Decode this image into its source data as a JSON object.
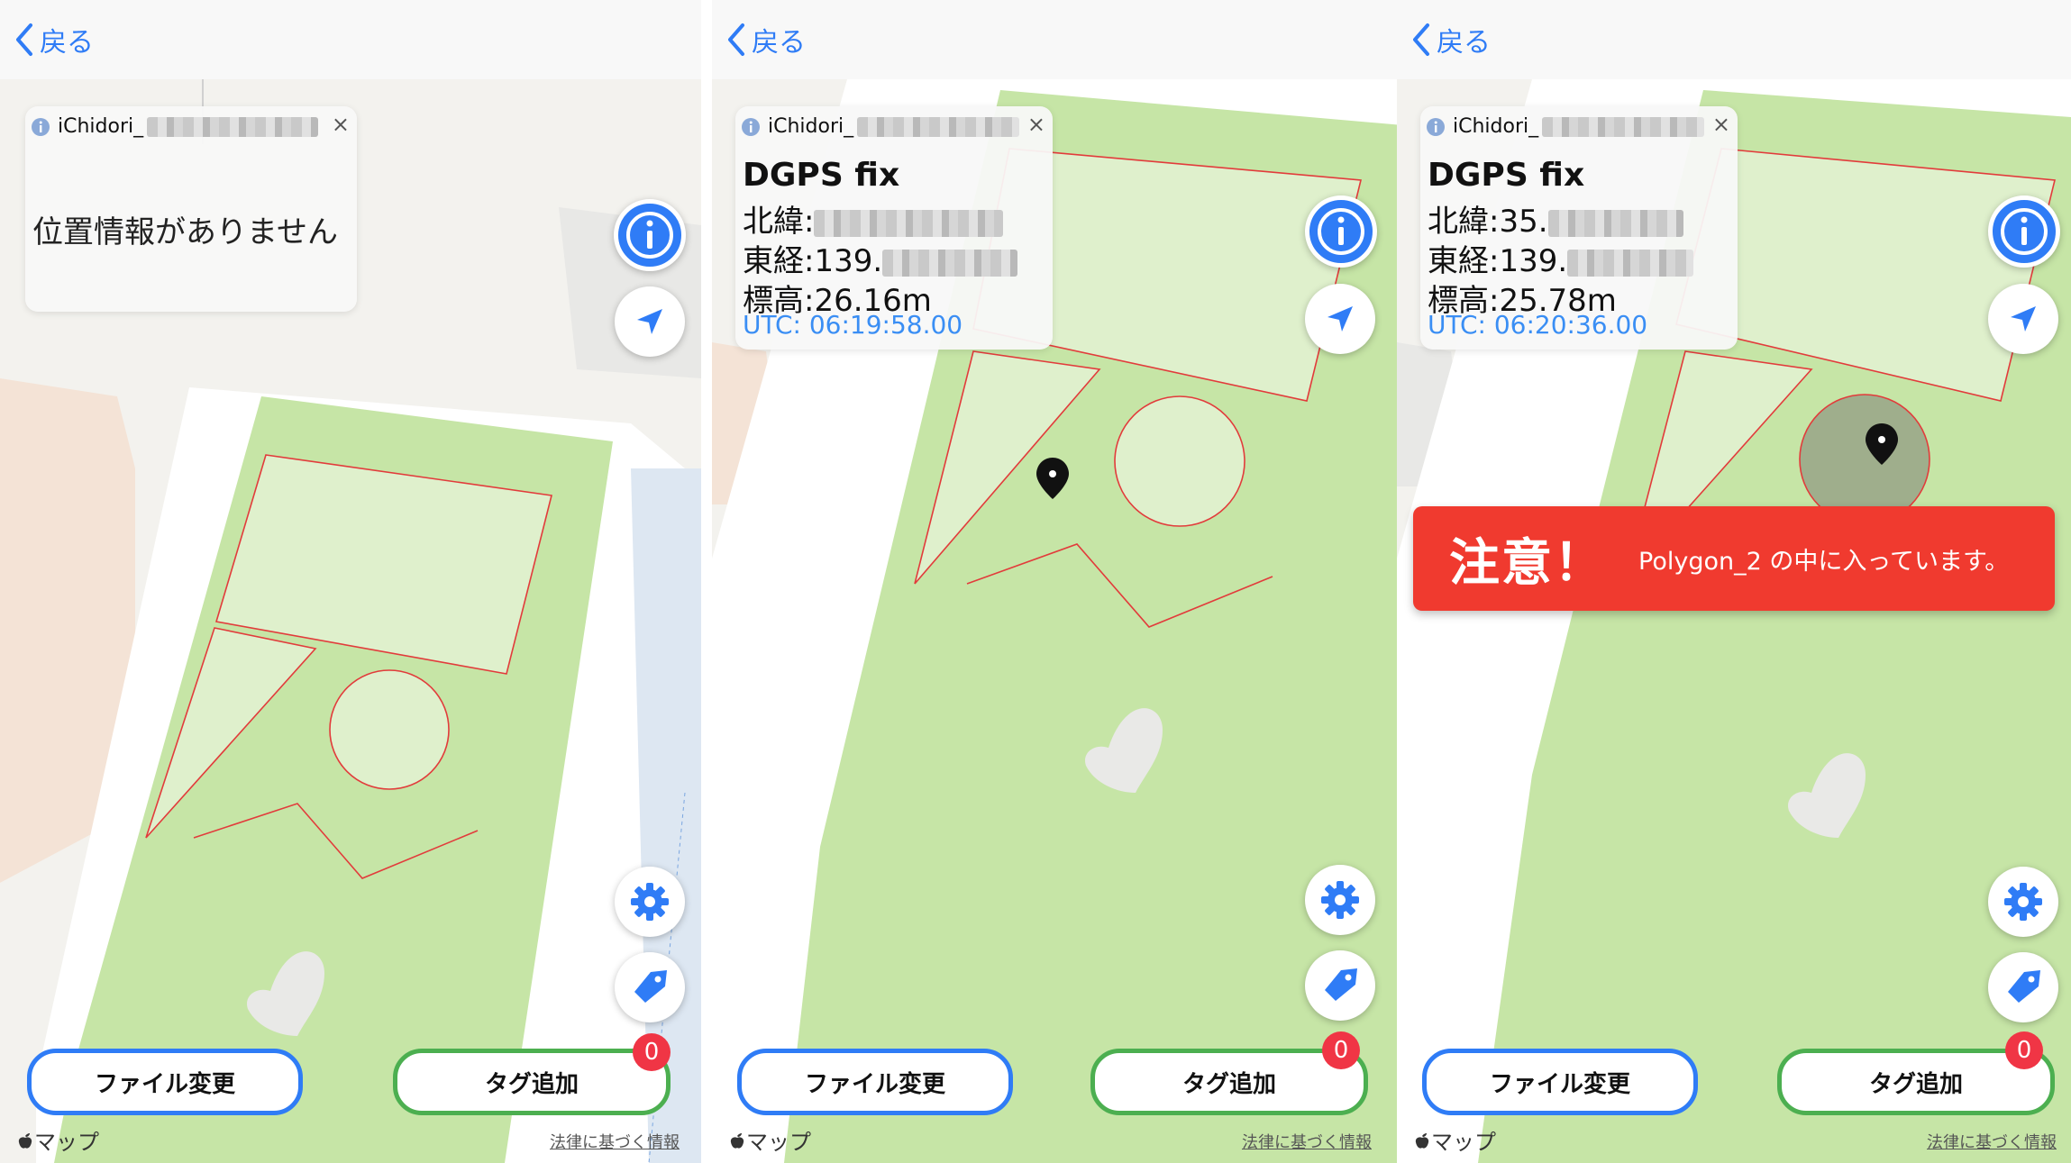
{
  "colors": {
    "accent_blue": "#2f7cf6",
    "green_border": "#4caf50",
    "badge_red": "#f03545",
    "alert_red": "#f03a2f",
    "park_green": "#c6e5a6",
    "zone_red": "#e23b3b",
    "utc_blue": "#3a8ef4"
  },
  "panels": [
    {
      "nav": {
        "back_label": "戻る"
      },
      "card": {
        "device": "iChidori_",
        "close": "×",
        "message": "位置情報がありません"
      },
      "buttons": {
        "file_change": "ファイル変更",
        "add_tag": "タグ追加",
        "badge_count": "0"
      },
      "footer": {
        "maps_label": "マップ",
        "legal": "法律に基づく情報"
      }
    },
    {
      "nav": {
        "back_label": "戻る"
      },
      "card": {
        "device": "iChidori_",
        "close": "×",
        "title": "DGPS fix",
        "lat_label": "北緯:",
        "lat_value": "",
        "lon_label": "東経:",
        "lon_value": "139.",
        "alt": "標高:26.16m",
        "utc": "UTC: 06:19:58.00"
      },
      "buttons": {
        "file_change": "ファイル変更",
        "add_tag": "タグ追加",
        "badge_count": "0"
      },
      "footer": {
        "maps_label": "マップ",
        "legal": "法律に基づく情報"
      }
    },
    {
      "nav": {
        "back_label": "戻る"
      },
      "card": {
        "device": "iChidori_",
        "close": "×",
        "title": "DGPS fix",
        "lat_label": "北緯:",
        "lat_value": "35.",
        "lon_label": "東経:",
        "lon_value": "139.",
        "alt": "標高:25.78m",
        "utc": "UTC: 06:20:36.00"
      },
      "alert": {
        "title": "注意！",
        "message": "Polygon_2 の中に入っています。"
      },
      "buttons": {
        "file_change": "ファイル変更",
        "add_tag": "タグ追加",
        "badge_count": "0"
      },
      "footer": {
        "maps_label": "マップ",
        "legal": "法律に基づく情報"
      }
    }
  ]
}
